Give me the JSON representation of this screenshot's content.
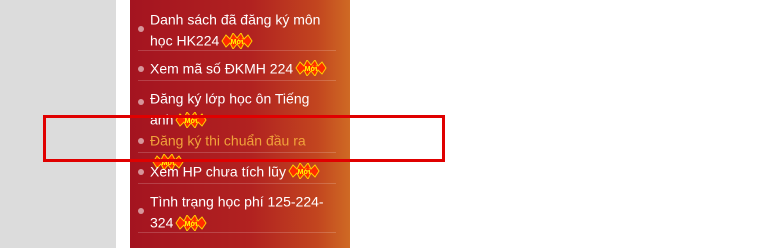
{
  "menu": {
    "items": [
      {
        "label": "Danh sách đã đăng ký môn học HK224",
        "badge": "Mới",
        "active": false
      },
      {
        "label": "Xem mã số ĐKMH 224",
        "badge": "Mới",
        "active": false
      },
      {
        "label": "Đăng ký lớp học ôn Tiếng anh",
        "badge": "Mới",
        "active": false
      },
      {
        "label": "Đăng ký thi chuẩn đầu ra",
        "badge": "Mới",
        "active": true
      },
      {
        "label": "Xem HP chưa tích lũy",
        "badge": "Mới",
        "active": false
      },
      {
        "label": "Tình trạng học phí 125-224-324",
        "badge": "Mới",
        "active": false
      }
    ]
  },
  "colors": {
    "panel_start": "#a41420",
    "panel_end": "#cf6a24",
    "active_text": "#f0a23a",
    "highlight_border": "#e00000"
  },
  "icons": {
    "bullet": "bullet-dot-icon",
    "badge": "new-badge-icon"
  }
}
